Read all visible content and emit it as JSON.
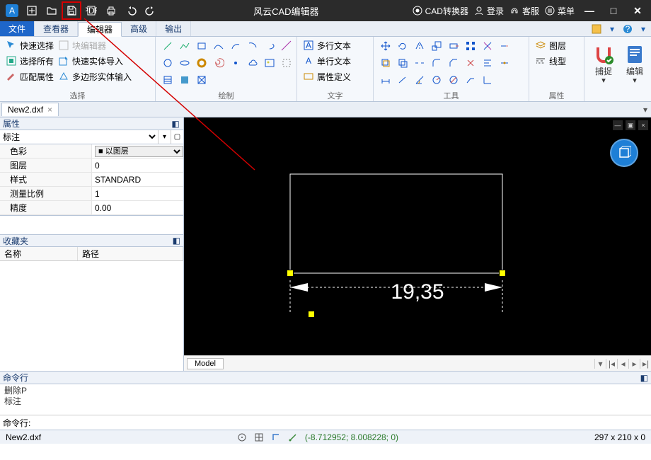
{
  "titlebar": {
    "title": "风云CAD编辑器",
    "converter": "CAD转换器",
    "login": "登录",
    "service": "客服",
    "menu": "菜单"
  },
  "menutabs": {
    "file": "文件",
    "viewer": "查看器",
    "editor": "编辑器",
    "advanced": "高级",
    "output": "输出"
  },
  "ribbon": {
    "select": {
      "label": "选择",
      "quick": "快速选择",
      "all": "选择所有",
      "match": "匹配属性",
      "blockedit": "块编辑器",
      "quickimport": "快速实体导入",
      "polyimport": "多边形实体输入"
    },
    "draw": {
      "label": "绘制"
    },
    "text": {
      "label": "文字",
      "mtext": "多行文本",
      "stext": "单行文本",
      "attdef": "属性定义"
    },
    "tools": {
      "label": "工具"
    },
    "props": {
      "label": "属性",
      "layer": "图层",
      "linetype": "线型"
    },
    "snap": "捕捉",
    "edit": "编辑"
  },
  "doctab": {
    "name": "New2.dxf"
  },
  "panels": {
    "properties": "属性",
    "favorites": "收藏夹",
    "fav_name": "名称",
    "fav_path": "路径"
  },
  "prop_selector": "标注",
  "prop_rows": {
    "color_k": "色彩",
    "color_v": "以图层",
    "layer_k": "图层",
    "layer_v": "0",
    "style_k": "样式",
    "style_v": "STANDARD",
    "scale_k": "测量比例",
    "scale_v": "1",
    "prec_k": "精度",
    "prec_v": "0.00"
  },
  "canvas": {
    "dim_text": "19,35",
    "model_tab": "Model"
  },
  "cmd": {
    "title": "命令行",
    "line1": "删除P",
    "line2": "标注",
    "prompt": "命令行:"
  },
  "status": {
    "file": "New2.dxf",
    "coords": "(-8.712952; 8.008228; 0)",
    "dims": "297 x 210 x 0"
  }
}
